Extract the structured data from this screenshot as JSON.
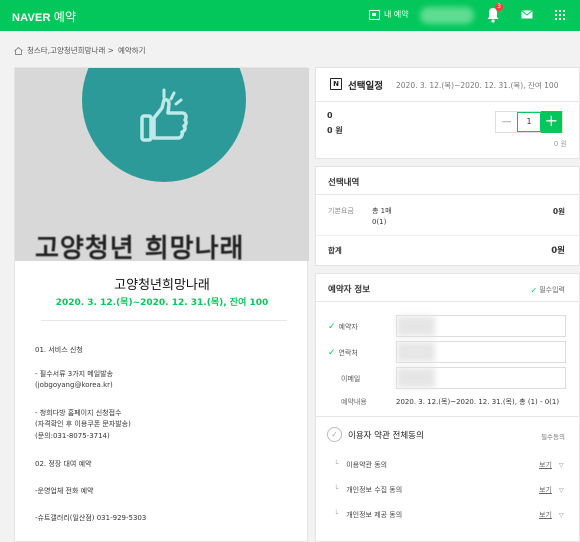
{
  "header": {
    "logo_brand": "NAVER",
    "logo_service": "예약",
    "my_reservation": "내 예약",
    "notification_count": "3"
  },
  "breadcrumb": {
    "items": [
      "청스타,고양청년희망나래 >",
      "예약하기"
    ]
  },
  "product": {
    "hero_text": "고양청년 희망나래",
    "title": "고양청년희망나래",
    "period": "2020. 3. 12.(목)~2020. 12. 31.(목), 잔여 100",
    "description": [
      "01. 서비스 신청",
      "- 필수서류 3가지 메일발송",
      "(jobgoyang@korea.kr)",
      "- 청희다방 홈페이지 신청접수",
      "(자격확인 후 이용쿠폰 문자발송)",
      "(문의:031-8075-3714)",
      "02. 정장 대여 예약",
      "-운영업체 전화 예약",
      "-슈트갤러리(일산점) 031-929-5303"
    ]
  },
  "schedule": {
    "label": "선택일정",
    "value": "2020. 3. 12.(목)~2020. 12. 31.(목), 잔여 100",
    "count": "0",
    "amount": "0 원",
    "quantity": "1",
    "unit_price": "0 원"
  },
  "selection": {
    "title": "선택내역",
    "base_label": "기본요금",
    "base_line1": "총 1매",
    "base_line2": "0(1)",
    "base_amount": "0원",
    "total_label": "합계",
    "total_amount": "0원"
  },
  "booker": {
    "title": "예약자 정보",
    "required": "필수입력",
    "fields": {
      "name": "예약자",
      "phone": "연락처",
      "email": "이메일"
    },
    "reservation_label": "예약내용",
    "reservation_value": "2020. 3. 12.(목)~2020. 12. 31.(목), 총 (1) - 0(1)",
    "agree_all": "이용자 약관 전체동의",
    "agree_required": "필수동의",
    "terms": [
      {
        "label": "이용약관 동의",
        "link": "보기"
      },
      {
        "label": "개인정보 수집 동의",
        "link": "보기"
      },
      {
        "label": "개인정보 제공 동의",
        "link": "보기"
      }
    ]
  },
  "colors": {
    "brand_green": "#03c75a",
    "badge_red": "#ff3c3c"
  },
  "icons": [
    "calendar-icon",
    "bell-icon",
    "mail-icon",
    "apps-grid-icon",
    "home-icon",
    "naver-n-icon",
    "check-icon",
    "minus-icon",
    "plus-icon",
    "chevron-down-icon"
  ]
}
